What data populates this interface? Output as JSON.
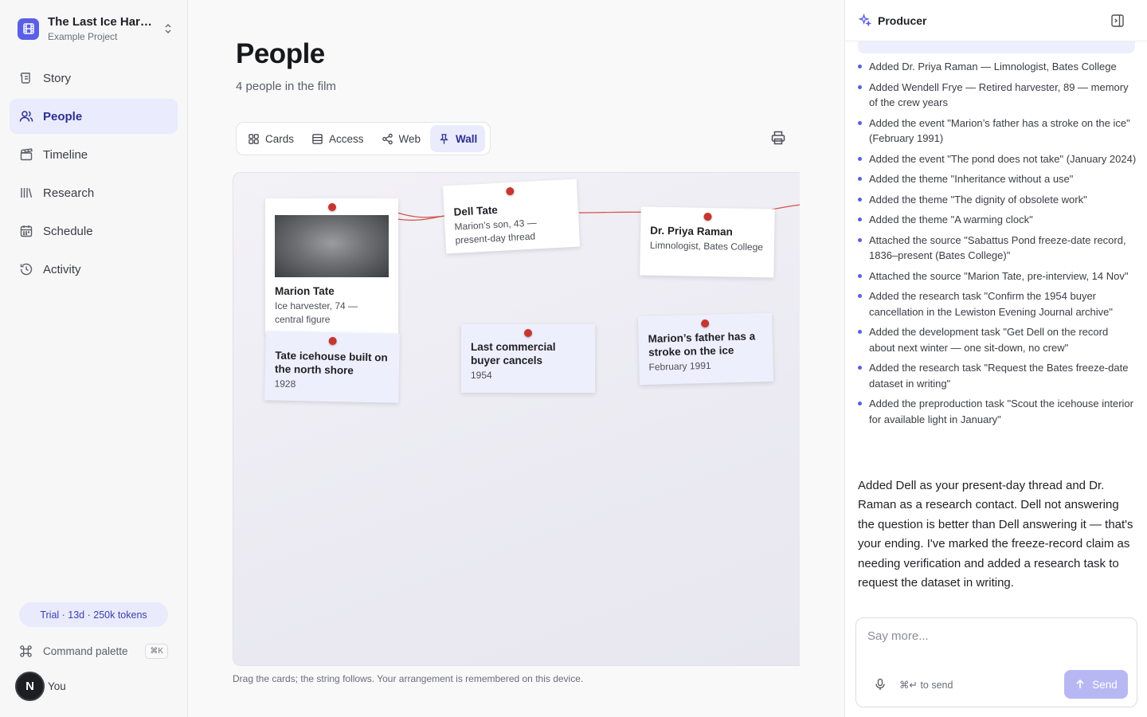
{
  "project": {
    "title": "The Last Ice Har…",
    "subtitle": "Example Project"
  },
  "nav": [
    {
      "label": "Story",
      "icon": "scroll-icon"
    },
    {
      "label": "People",
      "icon": "users-icon",
      "active": true
    },
    {
      "label": "Timeline",
      "icon": "clapperboard-icon"
    },
    {
      "label": "Research",
      "icon": "library-icon"
    },
    {
      "label": "Schedule",
      "icon": "calendar-icon"
    },
    {
      "label": "Activity",
      "icon": "history-icon"
    }
  ],
  "trial": "Trial · 13d · 250k tokens",
  "command_palette": {
    "label": "Command palette",
    "shortcut": "⌘K"
  },
  "user": {
    "initial": "N",
    "label": "You"
  },
  "page": {
    "title": "People",
    "subtitle": "4 people in the film"
  },
  "tabs": [
    {
      "label": "Cards",
      "icon": "grid-icon"
    },
    {
      "label": "Access",
      "icon": "list-icon"
    },
    {
      "label": "Web",
      "icon": "share-icon"
    },
    {
      "label": "Wall",
      "icon": "pin-icon",
      "active": true
    }
  ],
  "wall": {
    "cards": [
      {
        "title": "Marion Tate",
        "sub": "Ice harvester, 74 — central figure",
        "type": "person",
        "photo": true
      },
      {
        "title": "Dell Tate",
        "sub": "Marion’s son, 43 — present-day thread",
        "type": "person"
      },
      {
        "title": "Dr. Priya Raman",
        "sub": "Limnologist, Bates College",
        "type": "person"
      },
      {
        "title": "Tate icehouse built on the north shore",
        "sub": "1928",
        "type": "event"
      },
      {
        "title": "Last commercial buyer cancels",
        "sub": "1954",
        "type": "event"
      },
      {
        "title": "Marion’s father has a stroke on the ice",
        "sub": "February 1991",
        "type": "event"
      }
    ],
    "note": "Drag the cards; the string follows. Your arrangement is remembered on this device."
  },
  "panel": {
    "title": "Producer",
    "log": [
      "Added Dr. Priya Raman — Limnologist, Bates College",
      "Added Wendell Frye — Retired harvester, 89 — memory of the crew years",
      "Added the event \"Marion’s father has a stroke on the ice\" (February 1991)",
      "Added the event \"The pond does not take\" (January 2024)",
      "Added the theme \"Inheritance without a use\"",
      "Added the theme \"The dignity of obsolete work\"",
      "Added the theme \"A warming clock\"",
      "Attached the source \"Sabattus Pond freeze-date record, 1836–present (Bates College)\"",
      "Attached the source \"Marion Tate, pre-interview, 14 Nov\"",
      "Added the research task \"Confirm the 1954 buyer cancellation in the Lewiston Evening Journal archive\"",
      "Added the development task \"Get Dell on the record about next winter — one sit-down, no crew\"",
      "Added the research task \"Request the Bates freeze-date dataset in writing\"",
      "Added the preproduction task \"Scout the icehouse interior for available light in January\""
    ],
    "reply": "Added Dell as your present-day thread and Dr. Raman as a research contact. Dell not answering the question is better than Dell answering it — that's your ending. I've marked the freeze-record claim as needing verification and added a research task to request the dataset in writing.",
    "composer": {
      "placeholder": "Say more...",
      "hint": "⌘↵ to send",
      "send": "Send"
    }
  }
}
